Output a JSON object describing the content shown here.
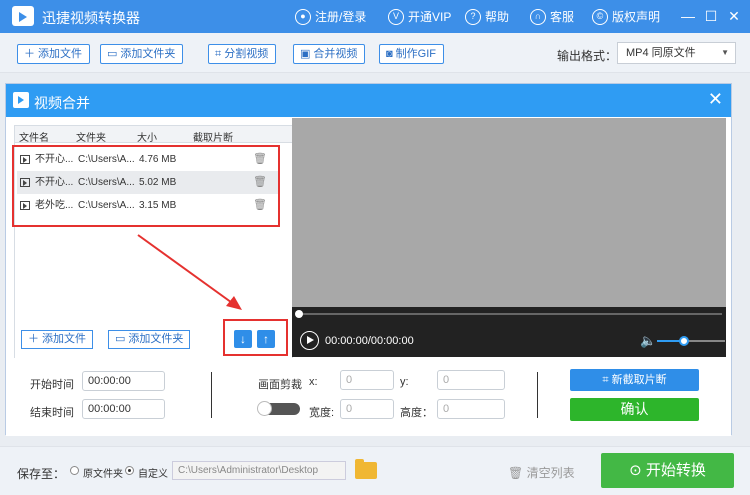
{
  "app": {
    "title": "迅捷视频转换器"
  },
  "topnav": [
    {
      "icon": "user-icon",
      "label": "注册/登录"
    },
    {
      "icon": "vip-icon",
      "label": "开通VIP"
    },
    {
      "icon": "help-icon",
      "label": "帮助"
    },
    {
      "icon": "headset-icon",
      "label": "客服"
    },
    {
      "icon": "copyright-icon",
      "label": "版权声明"
    }
  ],
  "window": {
    "minimize": "—",
    "maximize": "☐",
    "close": "✕"
  },
  "toolbar": {
    "add_file": "添加文件",
    "add_folder": "添加文件夹",
    "split_video": "分割视频",
    "merge_video": "合并视频",
    "make_gif": "制作GIF",
    "output_label": "输出格式：",
    "output_value": "MP4  同原文件"
  },
  "dialog": {
    "title": "视频合并",
    "columns": [
      "文件名",
      "文件夹",
      "大小",
      "截取片断"
    ],
    "rows": [
      {
        "name": "不开心...",
        "folder": "C:\\Users\\A...",
        "size": "4.76 MB"
      },
      {
        "name": "不开心...",
        "folder": "C:\\Users\\A...",
        "size": "5.02 MB"
      },
      {
        "name": "老外吃...",
        "folder": "C:\\Users\\A...",
        "size": "3.15 MB"
      }
    ],
    "add_file": "添加文件",
    "add_folder": "添加文件夹",
    "move_down": "↓",
    "move_up": "↑"
  },
  "player": {
    "time": "00:00:00/00:00:00",
    "volume_level": 0.4
  },
  "settings": {
    "start_label": "开始时间",
    "start_value": "00:00:00",
    "end_label": "结束时间",
    "end_value": "00:00:00",
    "crop_label": "画面剪裁",
    "x_label": "x:",
    "x_value": "0",
    "y_label": "y:",
    "y_value": "0",
    "width_label": "宽度:",
    "width_value": "0",
    "height_label": "高度：",
    "height_value": "0",
    "new_clip": "新截取片断",
    "confirm": "确认"
  },
  "bottom": {
    "save_label": "保存至：",
    "opt_original": "原文件夹",
    "opt_custom": "自定义",
    "path": "C:\\Users\\Administrator\\Desktop",
    "clear": "清空列表",
    "start": "开始转换"
  }
}
